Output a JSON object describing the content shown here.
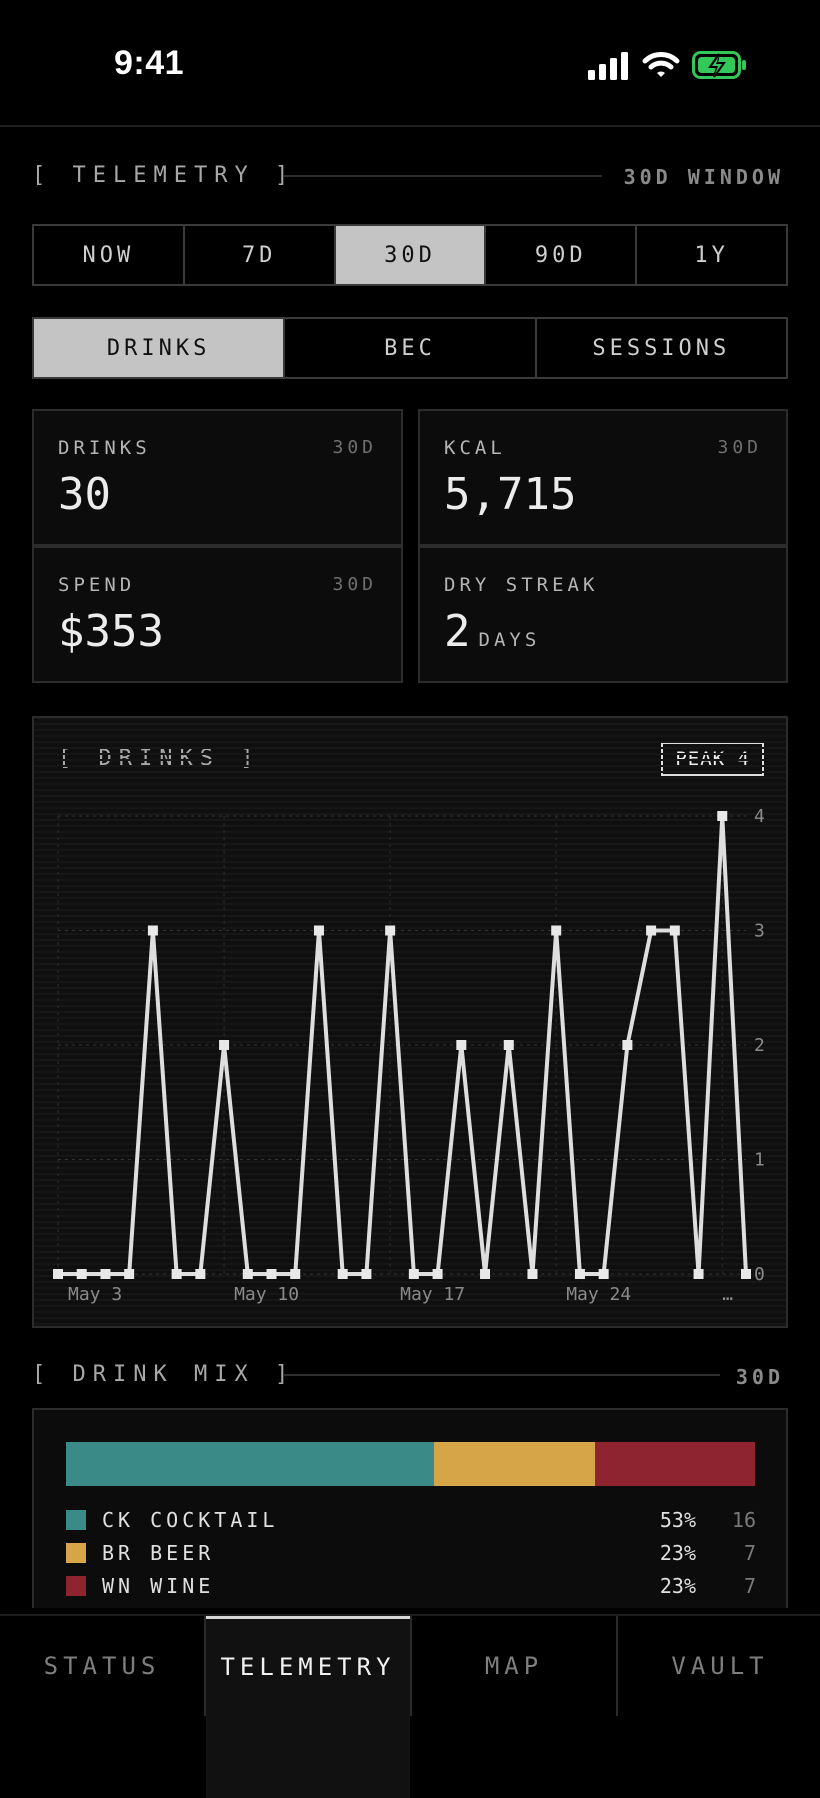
{
  "status_bar": {
    "time": "9:41"
  },
  "telemetry": {
    "title": "[ TELEMETRY ]",
    "window": "30D WINDOW"
  },
  "range_tabs": [
    "NOW",
    "7D",
    "30D",
    "90D",
    "1Y"
  ],
  "range_active": "30D",
  "metric_tabs": [
    "DRINKS",
    "BEC",
    "SESSIONS"
  ],
  "metric_active": "DRINKS",
  "stats": {
    "drinks": {
      "label": "DRINKS",
      "tag": "30D",
      "value": "30"
    },
    "kcal": {
      "label": "KCAL",
      "tag": "30D",
      "value": "5,715"
    },
    "spend": {
      "label": "SPEND",
      "tag": "30D",
      "value": "$353"
    },
    "dry_streak": {
      "label": "DRY STREAK",
      "value": "2",
      "unit": "DAYS"
    }
  },
  "chart": {
    "title": "[ DRINKS ]",
    "peak_label": "PEAK 4"
  },
  "chart_data": {
    "type": "line",
    "x_tick_labels": [
      "May 3",
      "May 10",
      "May 17",
      "May 24",
      "…"
    ],
    "values": [
      0,
      0,
      0,
      0,
      3,
      0,
      0,
      2,
      0,
      0,
      0,
      3,
      0,
      0,
      3,
      0,
      0,
      2,
      0,
      2,
      0,
      3,
      0,
      0,
      2,
      3,
      3,
      0,
      4,
      0
    ],
    "y_ticks": [
      0,
      1,
      2,
      3,
      4
    ],
    "ylim": [
      0,
      4
    ],
    "grid": true
  },
  "drink_mix": {
    "title": "[ DRINK MIX ]",
    "window": "30D",
    "segments": [
      {
        "code": "CK",
        "name": "COCKTAIL",
        "pct": "53%",
        "count": "16",
        "fraction": 0.533,
        "color": "#3a8a88"
      },
      {
        "code": "BR",
        "name": "BEER",
        "pct": "23%",
        "count": "7",
        "fraction": 0.233,
        "color": "#d6a548"
      },
      {
        "code": "WN",
        "name": "WINE",
        "pct": "23%",
        "count": "7",
        "fraction": 0.233,
        "color": "#8e2430"
      }
    ]
  },
  "tab_bar": {
    "items": [
      "STATUS",
      "TELEMETRY",
      "MAP",
      "VAULT"
    ],
    "active": "TELEMETRY"
  }
}
